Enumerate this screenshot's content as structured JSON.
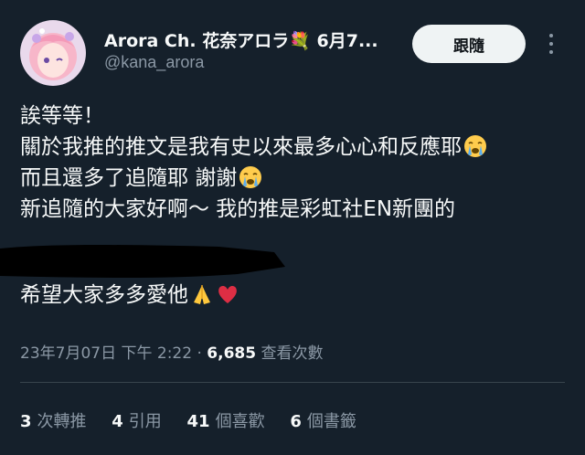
{
  "tweet": {
    "author": {
      "display_name": "Arora Ch. 花奈アロラ💐 6月7...",
      "handle": "@kana_arora",
      "avatar": "avatar-image"
    },
    "follow_label": "跟隨",
    "more_icon": "more-vertical-icon",
    "lines": [
      "誒等等！",
      "關於我推的推文是我有史以來最多心心和反應耶",
      "而且還多了追隨耶 謝謝",
      "新追隨的大家好啊〜 我的推是彩虹社EN新團的",
      "",
      "希望大家多多愛他"
    ],
    "emojis": [
      "crying-face-emoji",
      "crying-face-emoji",
      "folded-hands-emoji",
      "red-heart-emoji"
    ],
    "timestamp": "23年7月07日 下午 2:22",
    "separator": "·",
    "views_count": "6,685",
    "views_label": "查看次數",
    "stats": [
      {
        "count": "3",
        "label": "次轉推"
      },
      {
        "count": "4",
        "label": "引用"
      },
      {
        "count": "41",
        "label": "個喜歡"
      },
      {
        "count": "6",
        "label": "個書籤"
      }
    ],
    "colors": {
      "background": "#15202b",
      "text": "#f7f9f9",
      "secondary": "#8b98a5",
      "divider": "#38444d",
      "button": "#eff3f4"
    }
  }
}
